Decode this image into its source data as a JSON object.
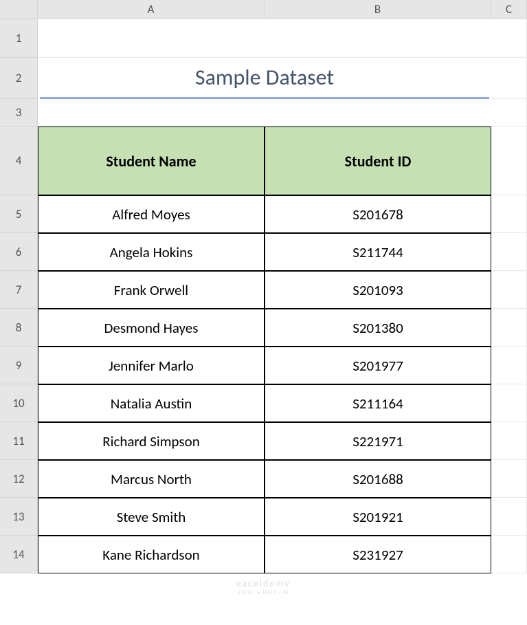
{
  "columns": [
    "A",
    "B",
    "C"
  ],
  "rowNumbers": [
    "1",
    "2",
    "3",
    "4",
    "5",
    "6",
    "7",
    "8",
    "9",
    "10",
    "11",
    "12",
    "13",
    "14"
  ],
  "title": "Sample Dataset",
  "headers": {
    "name": "Student Name",
    "id": "Student ID"
  },
  "students": [
    {
      "name": "Alfred Moyes",
      "id": "S201678"
    },
    {
      "name": "Angela Hokins",
      "id": "S211744"
    },
    {
      "name": "Frank Orwell",
      "id": "S201093"
    },
    {
      "name": "Desmond Hayes",
      "id": "S201380"
    },
    {
      "name": "Jennifer Marlo",
      "id": "S201977"
    },
    {
      "name": "Natalia Austin",
      "id": "S211164"
    },
    {
      "name": "Richard Simpson",
      "id": "S221971"
    },
    {
      "name": "Marcus North",
      "id": "S201688"
    },
    {
      "name": "Steve Smith",
      "id": "S201921"
    },
    {
      "name": "Kane Richardson",
      "id": "S231927"
    }
  ],
  "watermark": {
    "main": "exceldemy",
    "sub": "EXCEL & DATA - BI"
  }
}
